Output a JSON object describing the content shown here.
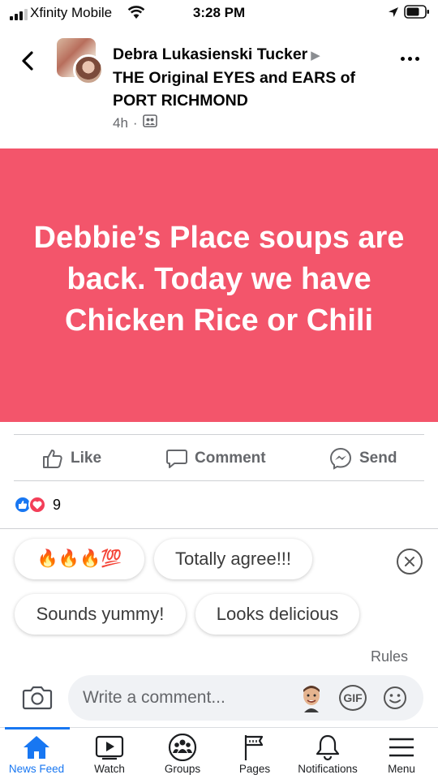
{
  "status_bar": {
    "carrier": "Xfinity Mobile",
    "time": "3:28 PM"
  },
  "post": {
    "author": "Debra Lukasienski Tucker",
    "group": "THE Original EYES and EARS of PORT RICHMOND",
    "time_ago": "4h",
    "privacy_icon": "group-members-icon",
    "background_color": "#f3556b",
    "text": "Debbie’s Place soups are back. Today we have Chicken Rice or Chili"
  },
  "actions": {
    "like": "Like",
    "comment": "Comment",
    "send": "Send"
  },
  "reactions": {
    "types": [
      "like",
      "love"
    ],
    "count": "9"
  },
  "quick_replies": [
    {
      "text": "🔥🔥🔥💯"
    },
    {
      "text": "Totally agree!!!"
    },
    {
      "text": "Sounds yummy!"
    },
    {
      "text": "Looks delicious"
    }
  ],
  "rules_label": "Rules",
  "composer": {
    "placeholder": "Write a comment...",
    "gif_label": "GIF"
  },
  "tabbar": {
    "items": [
      {
        "label": "News Feed",
        "icon": "home-icon",
        "active": true
      },
      {
        "label": "Watch",
        "icon": "watch-icon"
      },
      {
        "label": "Groups",
        "icon": "groups-icon"
      },
      {
        "label": "Pages",
        "icon": "pages-flag-icon"
      },
      {
        "label": "Notifications",
        "icon": "bell-icon"
      },
      {
        "label": "Menu",
        "icon": "menu-icon"
      }
    ]
  },
  "colors": {
    "accent": "#1877f2",
    "post_background": "#f3556b",
    "secondary_text": "#65676b"
  }
}
